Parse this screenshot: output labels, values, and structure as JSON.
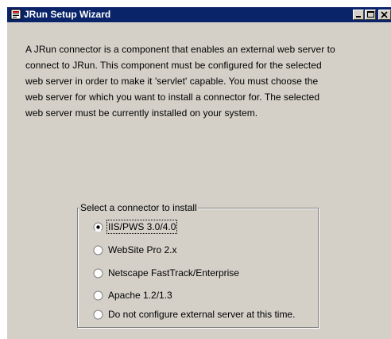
{
  "window": {
    "title": "JRun Setup Wizard",
    "titlebar_color": "#0a246a",
    "background_color": "#d4d0c8",
    "icon": "jrun-app-icon",
    "controls": [
      "minimize-icon",
      "maximize-icon",
      "close-icon"
    ]
  },
  "description": {
    "lines": [
      "A JRun connector is a component that enables an external web server to",
      "connect to JRun. This component must be configured for the selected",
      "web server in order to make it 'servlet' capable. You must choose the",
      "web server for which you want to install a connector for. The selected",
      "web server must be currently installed on your system."
    ]
  },
  "connector_group": {
    "legend": "Select a connector to install",
    "options": [
      {
        "label": "IIS/PWS 3.0/4.0",
        "selected": true
      },
      {
        "label": "WebSite Pro 2.x",
        "selected": false
      },
      {
        "label": "Netscape FastTrack/Enterprise",
        "selected": false
      },
      {
        "label": "Apache 1.2/1.3",
        "selected": false
      },
      {
        "label": "Do not configure external server at this time.",
        "selected": false
      }
    ]
  }
}
